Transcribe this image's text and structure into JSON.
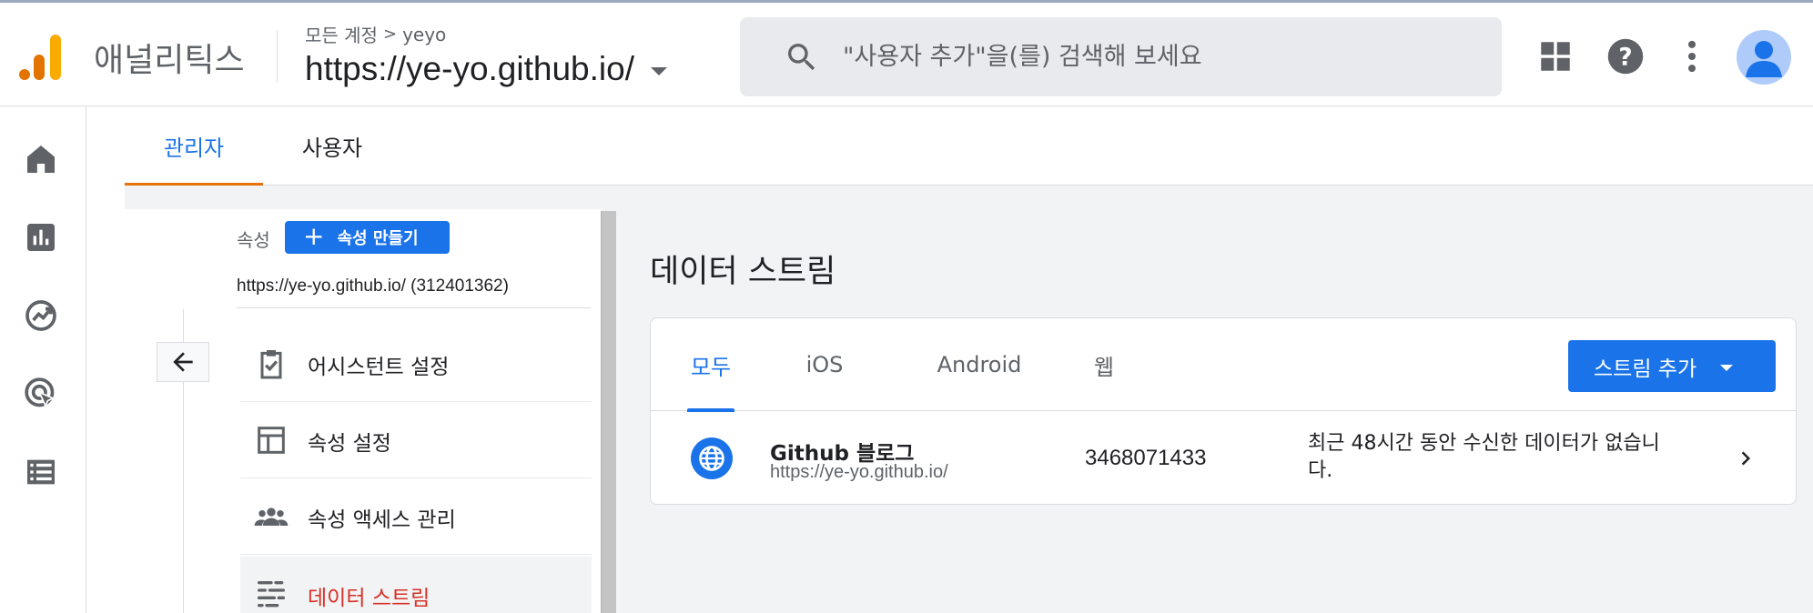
{
  "header": {
    "app_name": "애널리틱스",
    "breadcrumb": {
      "account": "모든 계정",
      "separator": ">",
      "user": "yeyo"
    },
    "property": "https://ye-yo.github.io/",
    "search_placeholder": "\"사용자 추가\"을(를) 검색해 보세요"
  },
  "rail": {
    "items": [
      "home-icon",
      "reports-icon",
      "explore-icon",
      "advertising-icon",
      "configure-icon"
    ]
  },
  "admin_tabs": [
    {
      "label": "관리자",
      "active": true
    },
    {
      "label": "사용자",
      "active": false
    }
  ],
  "property_column": {
    "label": "속성",
    "create_button": "속성 만들기",
    "property_name": "https://ye-yo.github.io/ (312401362)",
    "menu": [
      {
        "label": "어시스턴트 설정",
        "icon": "assistant-checklist-icon",
        "active": false
      },
      {
        "label": "속성 설정",
        "icon": "property-settings-icon",
        "active": false
      },
      {
        "label": "속성 액세스 관리",
        "icon": "people-icon",
        "active": false
      },
      {
        "label": "데이터 스트림",
        "icon": "data-stream-icon",
        "active": true
      }
    ]
  },
  "data_streams": {
    "title": "데이터 스트림",
    "tabs": [
      {
        "label": "모두",
        "active": true
      },
      {
        "label": "iOS",
        "active": false
      },
      {
        "label": "Android",
        "active": false
      },
      {
        "label": "웹",
        "active": false
      }
    ],
    "add_button": "스트림 추가",
    "rows": [
      {
        "name": "Github 블로그",
        "url": "https://ye-yo.github.io/",
        "id": "3468071433",
        "status": "최근 48시간 동안 수신한 데이터가 없습니다."
      }
    ]
  },
  "colors": {
    "accent": "#1a73e8",
    "tab_underline": "#e8710a",
    "active_menu_text": "#d93025"
  }
}
